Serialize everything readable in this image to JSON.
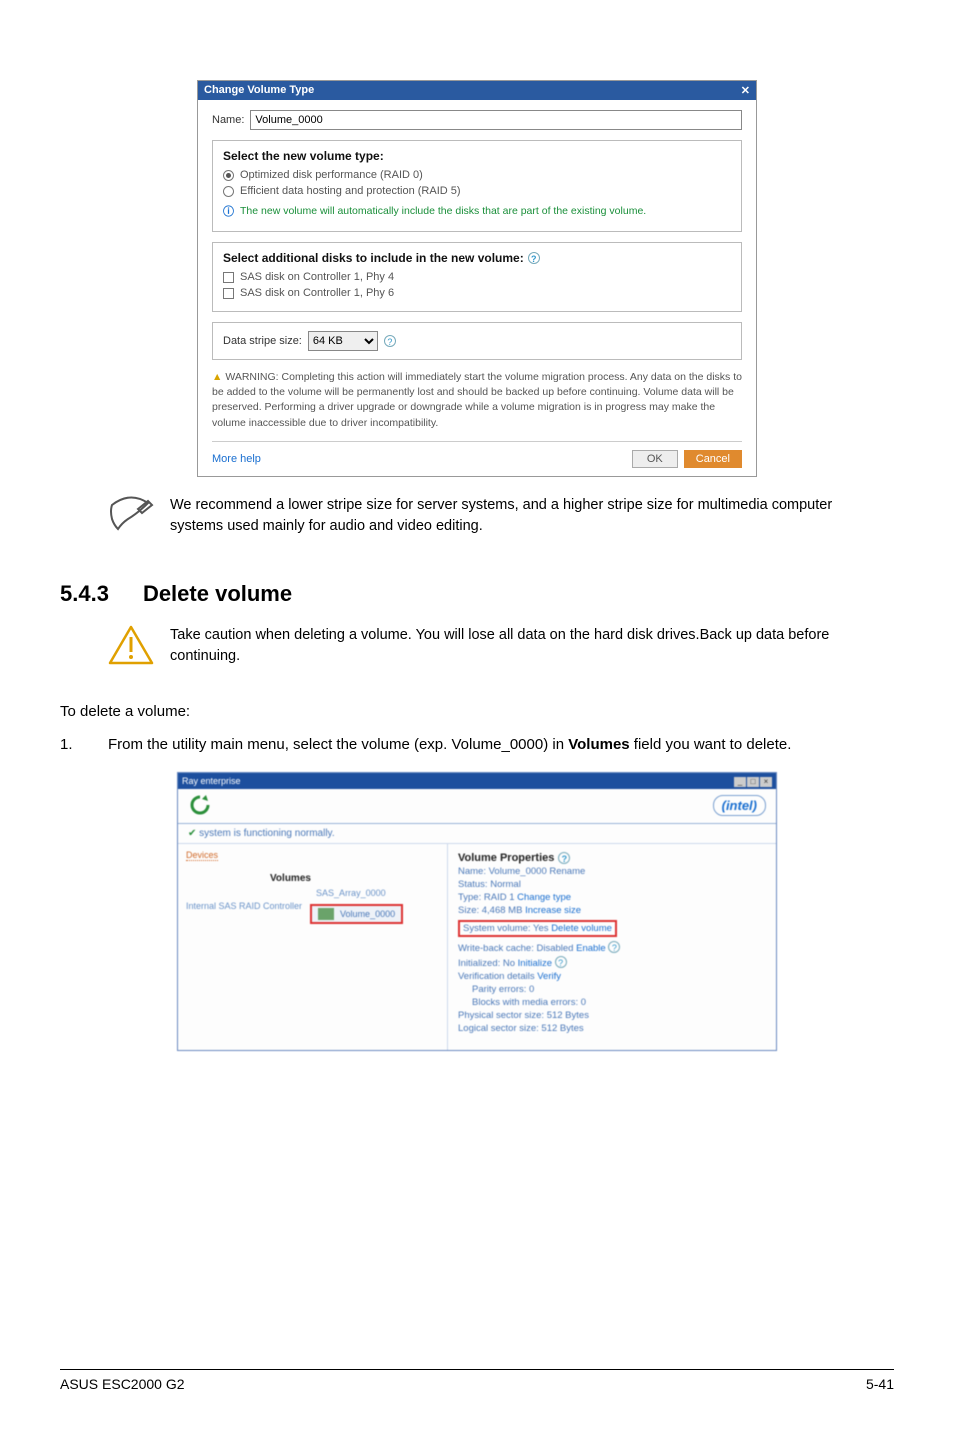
{
  "dialog1": {
    "title": "Change Volume Type",
    "name_label": "Name:",
    "name_value": "Volume_0000",
    "select_heading": "Select the new volume type:",
    "radio_optimized": "Optimized disk performance (RAID 0)",
    "radio_efficient": "Efficient data hosting and protection (RAID 5)",
    "info_note": "The new volume will automatically include the disks that are part of the existing volume.",
    "additional_heading": "Select additional disks to include in the new volume:",
    "chk_phy4": "SAS disk on Controller 1, Phy 4",
    "chk_phy6": "SAS disk on Controller 1, Phy 6",
    "stripe_label": "Data stripe size:",
    "stripe_value": "64 KB",
    "warning_text": "WARNING: Completing this action will immediately start the volume migration process. Any data on the disks to be added to the volume will be permanently lost and should be backed up before continuing. Volume data will be preserved. Performing a driver upgrade or downgrade while a volume migration is in progress may make the volume inaccessible due to driver incompatibility.",
    "more_help": "More help",
    "ok": "OK",
    "cancel": "Cancel"
  },
  "note1": "We recommend a lower stripe size for server systems, and a higher stripe size for multimedia computer systems used mainly for audio and video editing.",
  "section": {
    "num": "5.4.3",
    "title": "Delete volume"
  },
  "caution": "Take caution when deleting a volume. You will lose all data on the hard disk drives.Back up data before continuing.",
  "intro": "To delete a volume:",
  "step1_num": "1.",
  "step1_a": "From the utility main menu, select the volume (exp. Volume_0000) in ",
  "step1_b": "Volumes",
  "step1_c": " field you want to delete.",
  "dialog2": {
    "topbar": "Ray enterprise",
    "intel": "(intel)",
    "status": "system is functioning normally.",
    "devices": "Devices",
    "volumes_header": "Volumes",
    "controller": "Internal SAS RAID Controller",
    "array_label": "SAS_Array_0000",
    "vol_chip": "Volume_0000",
    "vp_title": "Volume Properties",
    "line_name": "Name: Volume_0000 Rename",
    "line_status": "Status: Normal",
    "line_type_a": "Type: RAID 1 ",
    "line_type_b": "Change type",
    "line_size_a": "Size: 4,468 MB ",
    "line_size_b": "Increase size",
    "line_sys_a": "System volume: Yes ",
    "line_sys_b": "Delete volume",
    "line_wb_a": "Write-back cache: Disabled ",
    "line_wb_b": "Enable",
    "line_init_a": "Initialized: No ",
    "line_init_b": "Initialize",
    "line_verif_a": "Verification details ",
    "line_verif_b": "Verify",
    "line_parity": "Parity errors: 0",
    "line_blocks": "Blocks with media errors: 0",
    "line_phys": "Physical sector size: 512 Bytes",
    "line_log": "Logical sector size: 512 Bytes"
  },
  "footer": {
    "left": "ASUS ESC2000 G2",
    "right": "5-41"
  }
}
